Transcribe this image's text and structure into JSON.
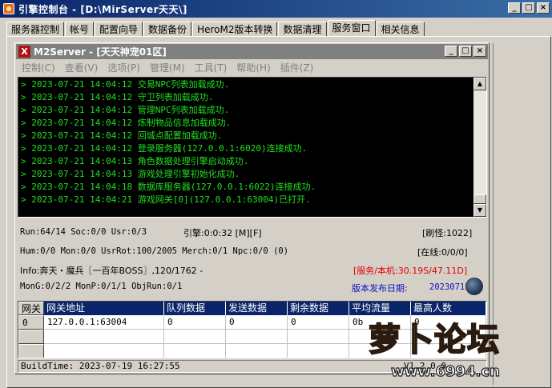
{
  "window": {
    "title": "引擎控制台 - [D:\\MirServer天天\\]"
  },
  "tabs": [
    {
      "label": "服务器控制"
    },
    {
      "label": "帐号"
    },
    {
      "label": "配置向导"
    },
    {
      "label": "数据备份"
    },
    {
      "label": "HeroM2版本转换"
    },
    {
      "label": "数据清理"
    },
    {
      "label": "服务窗口"
    },
    {
      "label": "相关信息"
    }
  ],
  "inner_window": {
    "title": "M2Server - [天天神宠01区]",
    "icon_letter": "X",
    "menu": [
      {
        "label": "控制(C)"
      },
      {
        "label": "查看(V)"
      },
      {
        "label": "选项(P)"
      },
      {
        "label": "管理(M)"
      },
      {
        "label": "工具(T)"
      },
      {
        "label": "帮助(H)"
      },
      {
        "label": "插件(Z)"
      }
    ]
  },
  "log": [
    "> 2023-07-21 14:04:12 交易NPC列表加载成功.",
    "> 2023-07-21 14:04:12 守卫列表加载成功.",
    "> 2023-07-21 14:04:12 管理NPC列表加载成功.",
    "> 2023-07-21 14:04:12 炼制物品信息加载成功.",
    "> 2023-07-21 14:04:12 回城点配置加载成功.",
    "> 2023-07-21 14:04:12 登录服务器(127.0.0.1:6020)连接成功.",
    "> 2023-07-21 14:04:13 角色数据处理引擎启动成功.",
    "> 2023-07-21 14:04:13 游戏处理引擎初始化成功.",
    "> 2023-07-21 14:04:18 数据库服务器(127.0.0.1:6022)连接成功.",
    "> 2023-07-21 14:04:21 游戏网关[0](127.0.0.1:63004)已打开."
  ],
  "stats": {
    "run": "Run:64/14 Soc:0/0 Usr:0/3",
    "engine": "引擎:0:0:32 [M][F]",
    "refresh": "[刷怪:1022]",
    "hum": "Hum:0/0 Mon:0/0 UsrRot:100/2005 Merch:0/1 Npc:0/0 (0)",
    "online": "[在线:0/0/0]",
    "info": "Info:奔天・魔兵〖一百年BOSS〗,120/1762 -",
    "service_ratio": "[服务/本机:30.19S/47.11D]",
    "mong": "MonG:0/2/2 MonP:0/1/1 ObjRun:0/1",
    "release_label": "版本发布日期:",
    "release_date": "20230719"
  },
  "grid": {
    "headers": [
      "网关",
      "网关地址",
      "队列数据",
      "发送数据",
      "剩余数据",
      "平均流量",
      "最高人数"
    ],
    "rows": [
      [
        "0",
        "127.0.0.1:63004",
        "0",
        "0",
        "0",
        "0b",
        "0"
      ],
      [
        "",
        "",
        "",
        "",
        "",
        "",
        ""
      ],
      [
        "",
        "",
        "",
        "",
        "",
        "",
        ""
      ]
    ]
  },
  "statusbar": {
    "build_time": "BuildTime: 2023-07-19 16:27:55",
    "version": "V1.2.0.0"
  },
  "watermark": {
    "text": "萝卜论坛",
    "url": "www.6994.cn",
    "color": "#f5e020"
  }
}
